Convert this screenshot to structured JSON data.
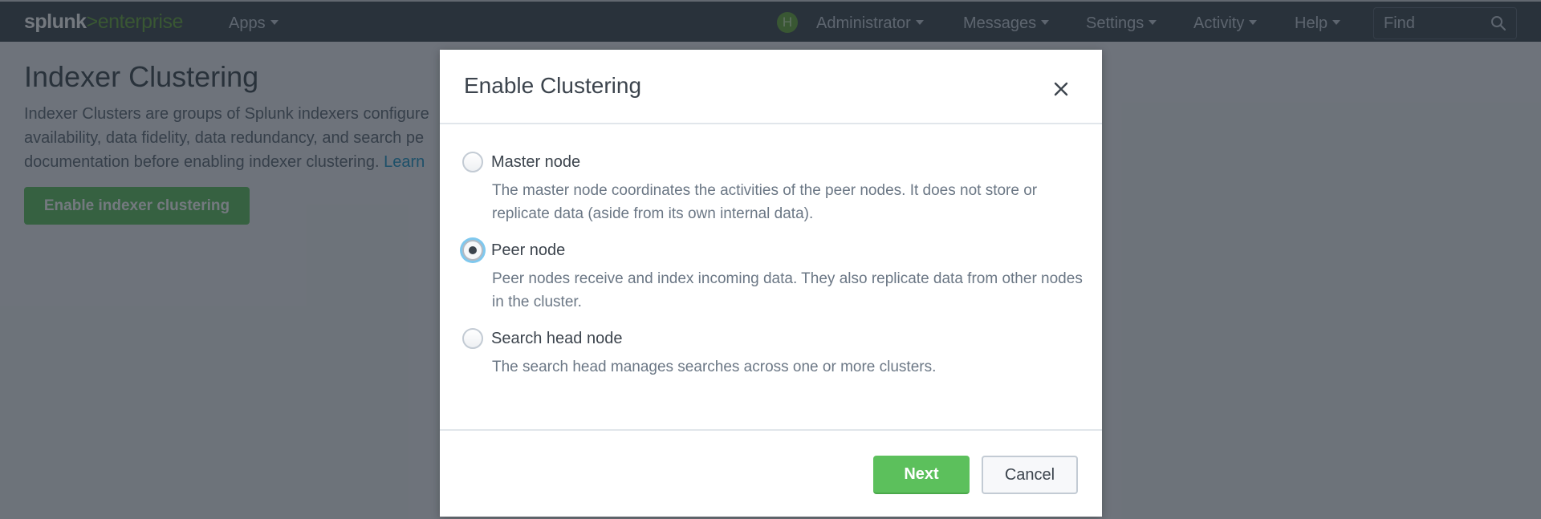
{
  "topbar": {
    "logo_brand": "splunk",
    "logo_separator": ">",
    "logo_product": "enterprise",
    "apps_label": "Apps",
    "avatar_initial": "H",
    "user_label": "Administrator",
    "messages_label": "Messages",
    "settings_label": "Settings",
    "activity_label": "Activity",
    "help_label": "Help",
    "find_placeholder": "Find"
  },
  "page": {
    "title": "Indexer Clustering",
    "description": "Indexer Clusters are groups of Splunk indexers configured to replicate each others' data, so that the system keeps multiple copies of all data. This process is known as index replication. Clusters provide availability, data fidelity, data redundancy, and search performance. Please read the documentation before enabling indexer clustering.",
    "description_visible_line1": "Indexer Clusters are groups of Splunk indexers configure",
    "description_visible_line2": "availability, data fidelity, data redundancy, and search pe",
    "description_visible_line3": "documentation before enabling indexer clustering. ",
    "learn_more": "Learn",
    "enable_button": "Enable indexer clustering"
  },
  "modal": {
    "title": "Enable Clustering",
    "close_icon": "close-icon",
    "options": [
      {
        "label": "Master node",
        "description": "The master node coordinates the activities of the peer nodes. It does not store or replicate data (aside from its own internal data).",
        "selected": false
      },
      {
        "label": "Peer node",
        "description": "Peer nodes receive and index incoming data. They also replicate data from other nodes in the cluster.",
        "selected": true
      },
      {
        "label": "Search head node",
        "description": "The search head manages searches across one or more clusters.",
        "selected": false
      }
    ],
    "next_label": "Next",
    "cancel_label": "Cancel"
  },
  "colors": {
    "topbar_bg": "#3c444d",
    "brand_green": "#65a637",
    "primary_button": "#5cc05c",
    "focus_ring": "#7fc8ee",
    "text_dark": "#3c444d",
    "text_muted": "#6b7785"
  }
}
